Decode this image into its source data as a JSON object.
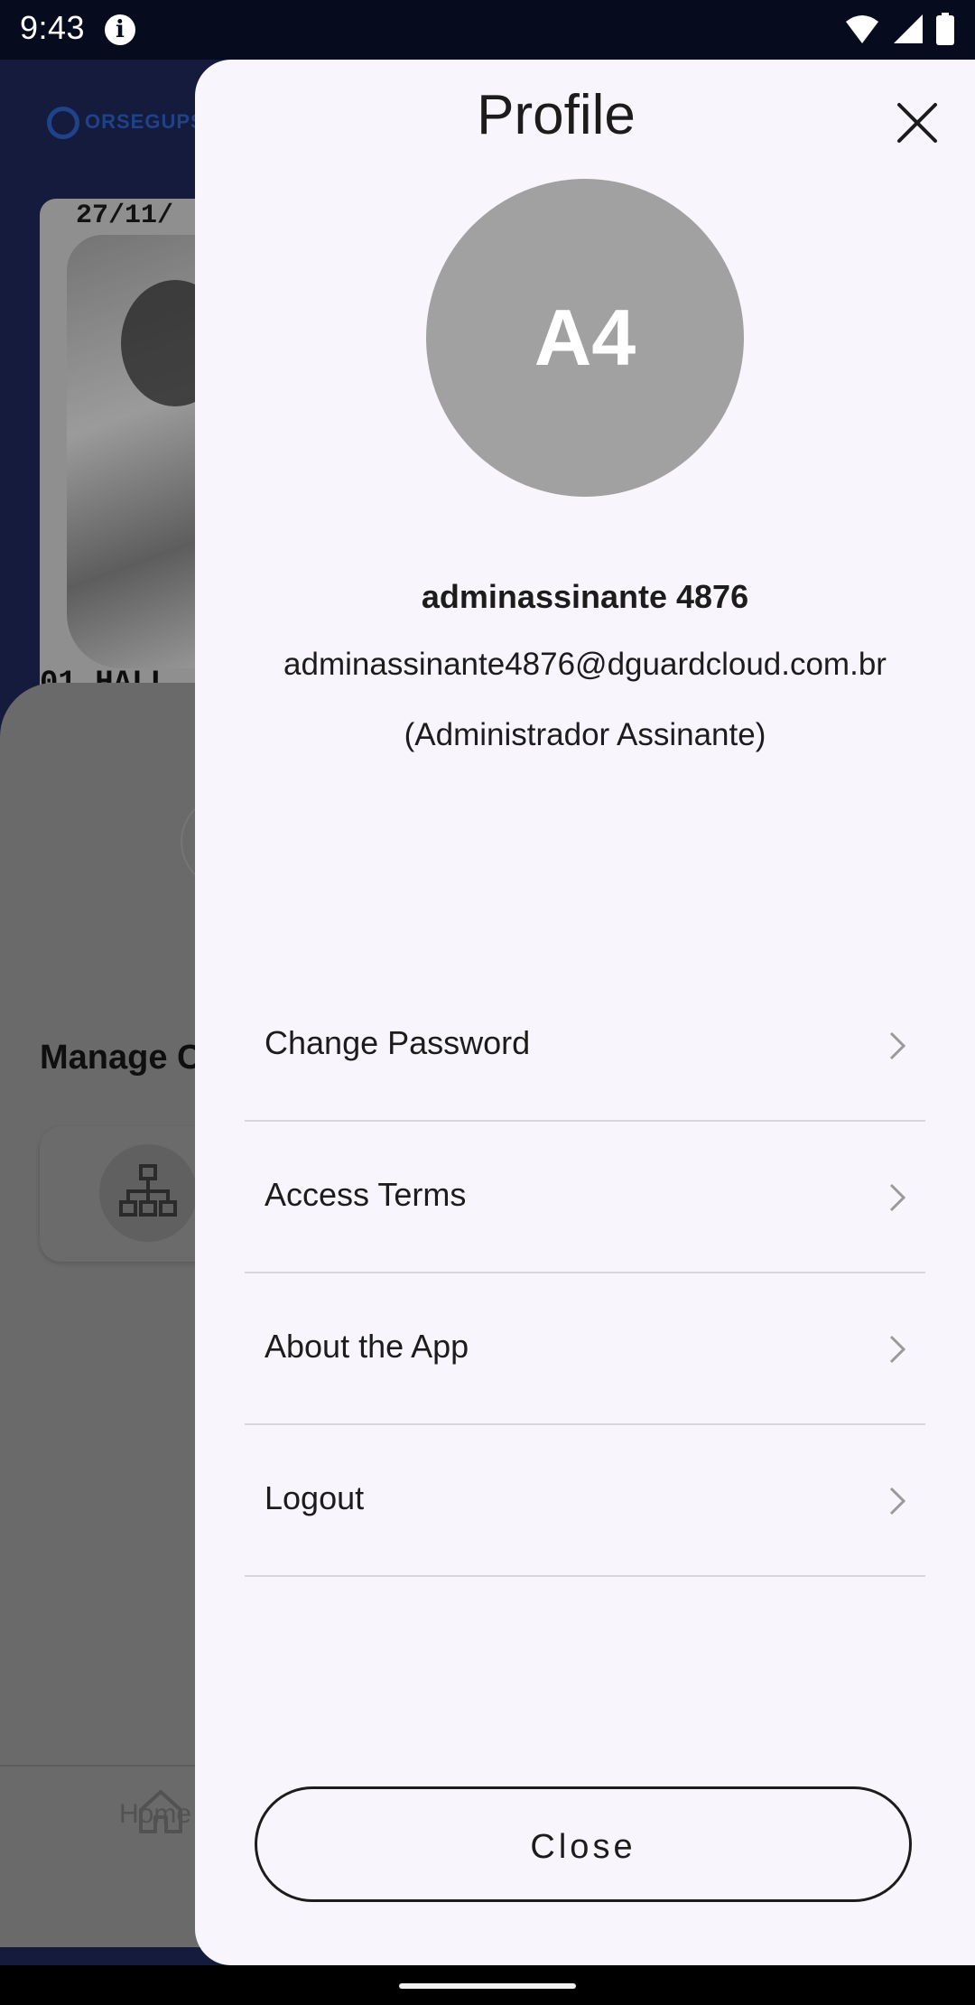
{
  "status_bar": {
    "time": "9:43",
    "icons": [
      "info-icon",
      "wifi-icon",
      "signal-icon",
      "battery-icon"
    ]
  },
  "background": {
    "logo_text": "ORSEGUPS",
    "camera_timestamp": "27/11/",
    "camera_label": "01 HALL",
    "section_heading": "Manage C",
    "nav_home_label": "Home"
  },
  "profile": {
    "title": "Profile",
    "avatar_initials": "A4",
    "name": "adminassinante 4876",
    "email": "adminassinante4876@dguardcloud.com.br",
    "role": "(Administrador Assinante)",
    "menu": [
      {
        "label": "Change Password"
      },
      {
        "label": "Access Terms"
      },
      {
        "label": "About the App"
      },
      {
        "label": "Logout"
      }
    ],
    "close_button_label": "Close"
  },
  "colors": {
    "drawer_bg": "#f8f6fc",
    "avatar_bg": "#a1a1a1",
    "status_bar_bg": "#060c1e",
    "divider": "#d9d7de"
  }
}
